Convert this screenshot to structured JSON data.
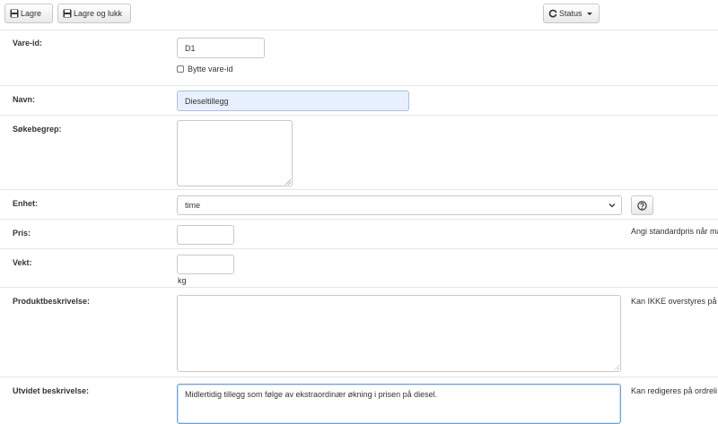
{
  "toolbar": {
    "save_label": "Lagre",
    "save_close_label": "Lagre og lukk",
    "status_label": "Status"
  },
  "fields": {
    "vare_id": {
      "label": "Vare-id:",
      "value": "D1",
      "checkbox_label": "Bytte vare-id"
    },
    "navn": {
      "label": "Navn:",
      "value": "Dieseltillegg"
    },
    "sokebegrep": {
      "label": "Søkebegrep:",
      "value": ""
    },
    "enhet": {
      "label": "Enhet:",
      "value": "time"
    },
    "pris": {
      "label": "Pris:",
      "value": "",
      "help": "Angi standardpris når ma"
    },
    "vekt": {
      "label": "Vekt:",
      "value": "",
      "unit": "kg"
    },
    "produktbeskrivelse": {
      "label": "Produktbeskrivelse:",
      "value": "",
      "help": "Kan IKKE overstyres på"
    },
    "utvidet": {
      "label": "Utvidet beskrivelse:",
      "value": "Midlertidig tillegg som følge av ekstraordinær økning i prisen på diesel.",
      "help": "Kan redigeres på ordreli"
    }
  },
  "icons": {
    "save": "floppy-disk-icon",
    "status": "refresh-icon",
    "help": "question-circle-icon",
    "dropdown": "chevron-down-icon"
  }
}
